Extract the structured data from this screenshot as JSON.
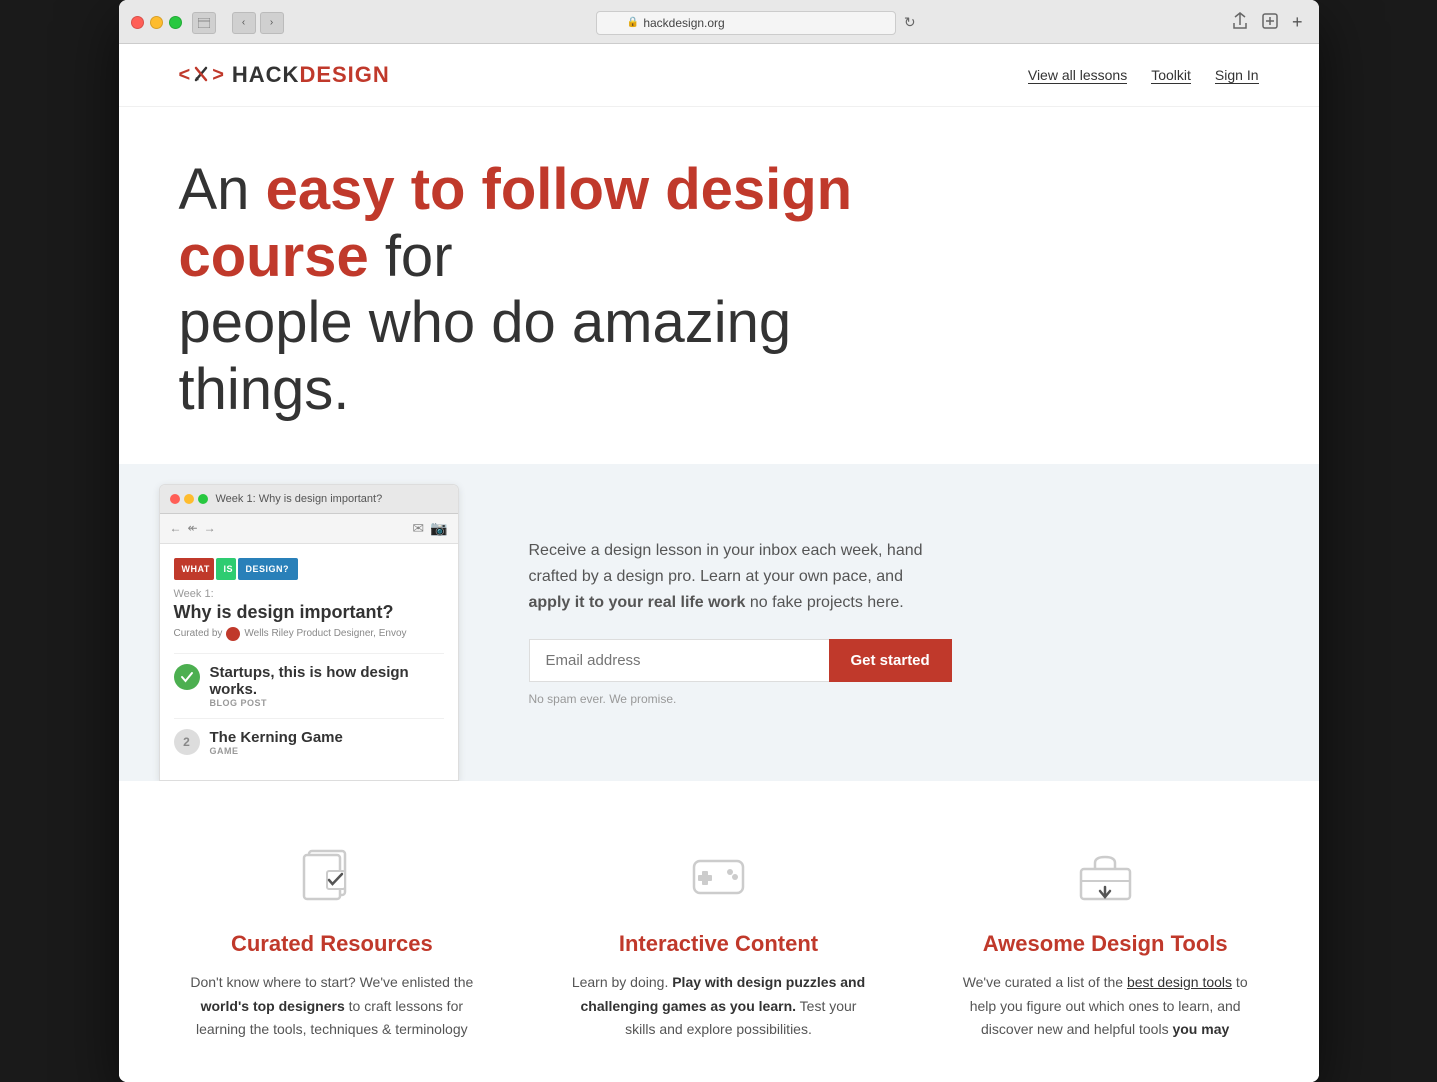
{
  "browser": {
    "url": "hackdesign.org",
    "window_controls": {
      "red_label": "close",
      "yellow_label": "minimize",
      "green_label": "maximize"
    }
  },
  "header": {
    "logo": {
      "hack": "HACK",
      "design": "DESIGN"
    },
    "nav": {
      "view_all_lessons": "View all lessons",
      "toolkit": "Toolkit",
      "sign_in": "Sign In"
    }
  },
  "hero": {
    "line1_prefix": "An ",
    "line1_highlight": "easy to follow design course",
    "line1_suffix": " for",
    "line2": "people who do amazing things."
  },
  "email_mockup": {
    "title": "Week 1: Why is design important?",
    "week_label": "Week 1:",
    "email_title": "Why is design important?",
    "curated_by": "Curated by",
    "curator": "Wells Riley Product Designer, Envoy",
    "color_bars": [
      "WHAT",
      "IS",
      "DESIGN?"
    ],
    "item1_title": "Startups, this is how design works.",
    "item1_type": "BLOG POST",
    "item2_num": "2",
    "item2_title": "The Kerning Game",
    "item2_type": "GAME"
  },
  "email_cta": {
    "description_plain": "Receive a design lesson in your inbox each week, hand crafted by a design pro. Learn at your own pace, and ",
    "description_bold": "apply it to your real life work",
    "description_end": " no fake projects here.",
    "email_placeholder": "Email address",
    "button_label": "Get started",
    "no_spam": "No spam ever. We promise."
  },
  "features": {
    "items": [
      {
        "id": "curated-resources",
        "title": "Curated Resources",
        "description_plain": "Don't know where to start? We've enlisted the ",
        "description_bold": "world's top designers",
        "description_end": " to craft lessons for learning the tools, techniques & terminology"
      },
      {
        "id": "interactive-content",
        "title": "Interactive Content",
        "description_plain": "Learn by doing. ",
        "description_bold": "Play with design puzzles and challenging games as you learn.",
        "description_end": " Test your skills and explore possibilities."
      },
      {
        "id": "awesome-design-tools",
        "title": "Awesome Design Tools",
        "description_plain": "We've curated a list of the ",
        "description_link": "best design tools",
        "description_end_bold": " to help you figure out which ones to learn, and discover new and helpful tools ",
        "description_end_bold2": "you may"
      }
    ]
  }
}
